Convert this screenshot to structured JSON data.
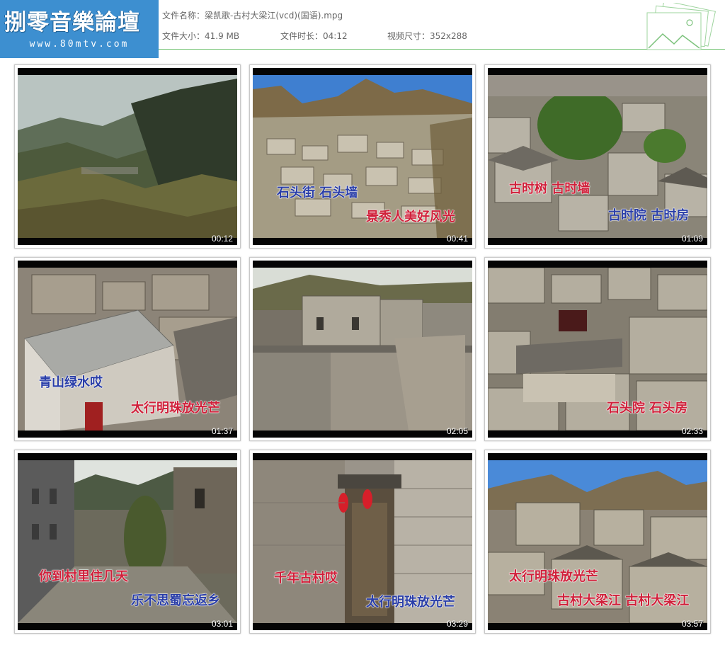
{
  "logo": {
    "title": "捌零音樂論壇",
    "url": "www.80mtv.com"
  },
  "file": {
    "name_label": "文件名称：",
    "name": "梁凯歌-古村大梁江(vcd)(国语).mpg",
    "size_label": "文件大小：",
    "size": "41.9 MB",
    "duration_label": "文件时长：",
    "duration": "04:12",
    "resolution_label": "视频尺寸：",
    "resolution": "352x288"
  },
  "thumbnails": [
    {
      "time": "00:12",
      "lyrics": []
    },
    {
      "time": "00:41",
      "lyrics": [
        {
          "text": "石头街 石头墙",
          "color": "blue"
        },
        {
          "text": "景秀人美好风光",
          "color": "red"
        }
      ]
    },
    {
      "time": "01:09",
      "lyrics": [
        {
          "text": "古时树 古时墙",
          "color": "red"
        },
        {
          "text": "古时院 古时房",
          "color": "blue"
        }
      ]
    },
    {
      "time": "01:37",
      "lyrics": [
        {
          "text": "青山绿水哎",
          "color": "blue"
        },
        {
          "text": "太行明珠放光芒",
          "color": "red"
        }
      ]
    },
    {
      "time": "02:05",
      "lyrics": []
    },
    {
      "time": "02:33",
      "lyrics": [
        {
          "text": "石头院 石头房",
          "color": "red"
        }
      ]
    },
    {
      "time": "03:01",
      "lyrics": [
        {
          "text": "你到村里住几天",
          "color": "red"
        },
        {
          "text": "乐不思蜀忘返乡",
          "color": "blue"
        }
      ]
    },
    {
      "time": "03:29",
      "lyrics": [
        {
          "text": "千年古村哎",
          "color": "red"
        },
        {
          "text": "太行明珠放光芒",
          "color": "blue"
        }
      ]
    },
    {
      "time": "03:57",
      "lyrics": [
        {
          "text": "太行明珠放光芒",
          "color": "red"
        },
        {
          "text": "古村大梁江 古村大梁江",
          "color": "red"
        }
      ]
    }
  ]
}
